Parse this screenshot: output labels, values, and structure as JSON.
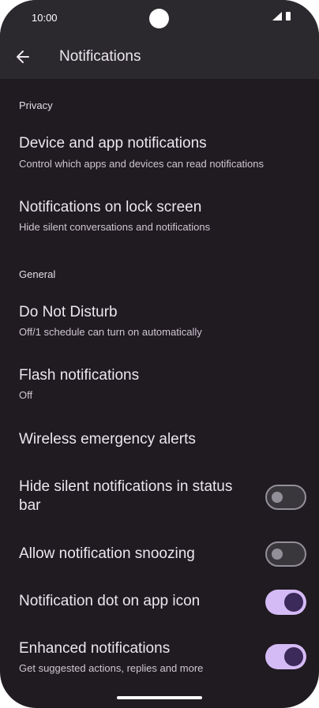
{
  "status_bar": {
    "time": "10:00"
  },
  "header": {
    "title": "Notifications"
  },
  "sections": {
    "privacy": "Privacy",
    "general": "General"
  },
  "items": {
    "device_app": {
      "title": "Device and app notifications",
      "subtitle": "Control which apps and devices can read notifications"
    },
    "lock_screen": {
      "title": "Notifications on lock screen",
      "subtitle": "Hide silent conversations and notifications"
    },
    "dnd": {
      "title": "Do Not Disturb",
      "subtitle": "Off/1 schedule can turn on automatically"
    },
    "flash": {
      "title": "Flash notifications",
      "subtitle": "Off"
    },
    "wireless": {
      "title": "Wireless emergency alerts"
    },
    "hide_silent": {
      "title": "Hide silent notifications in status bar",
      "checked": false
    },
    "snooze": {
      "title": "Allow notification snoozing",
      "checked": false
    },
    "dot": {
      "title": "Notification dot on app icon",
      "checked": true
    },
    "enhanced": {
      "title": "Enhanced notifications",
      "subtitle": "Get suggested actions, replies and more",
      "checked": true
    }
  },
  "colors": {
    "background": "#1f1b21",
    "app_bar": "#2b292d",
    "toggle_on_track": "#d5bbf6",
    "toggle_on_knob": "#3c2a5a",
    "toggle_off_outline": "#938f99"
  },
  "icons": {
    "back": "arrow-back-icon",
    "signal": "signal-icon",
    "battery": "battery-icon"
  }
}
